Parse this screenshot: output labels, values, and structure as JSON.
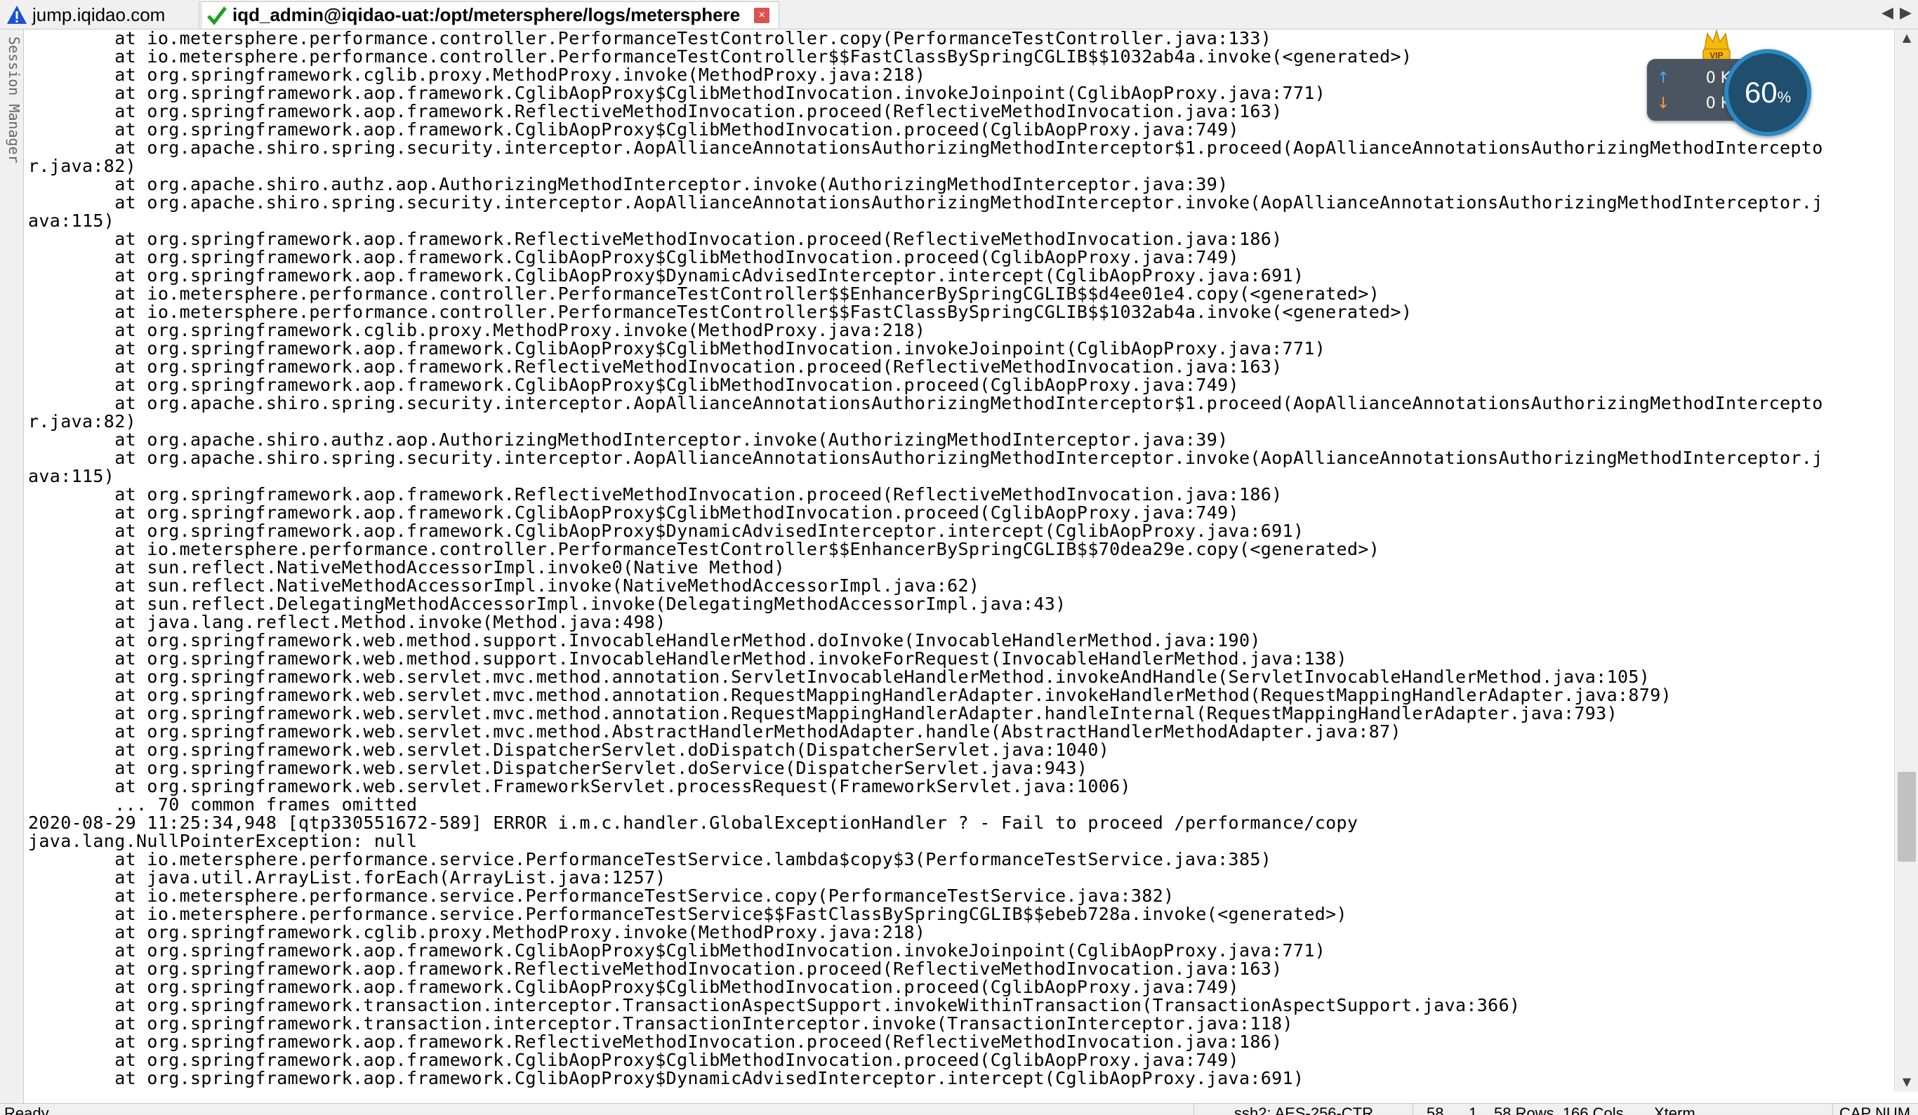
{
  "tabs": [
    {
      "label": "jump.iqidao.com",
      "icon": "warning-icon",
      "color": "#1a4fd6"
    },
    {
      "label": "iqd_admin@iqidao-uat:/opt/metersphere/logs/metersphere",
      "icon": "checkmark-icon",
      "color": "#1aa11a"
    }
  ],
  "side_panel": {
    "label": "Session Manager"
  },
  "network_widget": {
    "upload": "0 K/s",
    "download": "0 K/s",
    "percent": "60",
    "percent_unit": "%",
    "badge": "VIP"
  },
  "terminal": {
    "lines": [
      "        at io.metersphere.performance.controller.PerformanceTestController.copy(PerformanceTestController.java:133)",
      "        at io.metersphere.performance.controller.PerformanceTestController$$FastClassBySpringCGLIB$$1032ab4a.invoke(<generated>)",
      "        at org.springframework.cglib.proxy.MethodProxy.invoke(MethodProxy.java:218)",
      "        at org.springframework.aop.framework.CglibAopProxy$CglibMethodInvocation.invokeJoinpoint(CglibAopProxy.java:771)",
      "        at org.springframework.aop.framework.ReflectiveMethodInvocation.proceed(ReflectiveMethodInvocation.java:163)",
      "        at org.springframework.aop.framework.CglibAopProxy$CglibMethodInvocation.proceed(CglibAopProxy.java:749)",
      "        at org.apache.shiro.spring.security.interceptor.AopAllianceAnnotationsAuthorizingMethodInterceptor$1.proceed(AopAllianceAnnotationsAuthorizingMethodIntercepto",
      "r.java:82)",
      "        at org.apache.shiro.authz.aop.AuthorizingMethodInterceptor.invoke(AuthorizingMethodInterceptor.java:39)",
      "        at org.apache.shiro.spring.security.interceptor.AopAllianceAnnotationsAuthorizingMethodInterceptor.invoke(AopAllianceAnnotationsAuthorizingMethodInterceptor.j",
      "ava:115)",
      "        at org.springframework.aop.framework.ReflectiveMethodInvocation.proceed(ReflectiveMethodInvocation.java:186)",
      "        at org.springframework.aop.framework.CglibAopProxy$CglibMethodInvocation.proceed(CglibAopProxy.java:749)",
      "        at org.springframework.aop.framework.CglibAopProxy$DynamicAdvisedInterceptor.intercept(CglibAopProxy.java:691)",
      "        at io.metersphere.performance.controller.PerformanceTestController$$EnhancerBySpringCGLIB$$d4ee01e4.copy(<generated>)",
      "        at io.metersphere.performance.controller.PerformanceTestController$$FastClassBySpringCGLIB$$1032ab4a.invoke(<generated>)",
      "        at org.springframework.cglib.proxy.MethodProxy.invoke(MethodProxy.java:218)",
      "        at org.springframework.aop.framework.CglibAopProxy$CglibMethodInvocation.invokeJoinpoint(CglibAopProxy.java:771)",
      "        at org.springframework.aop.framework.ReflectiveMethodInvocation.proceed(ReflectiveMethodInvocation.java:163)",
      "        at org.springframework.aop.framework.CglibAopProxy$CglibMethodInvocation.proceed(CglibAopProxy.java:749)",
      "        at org.apache.shiro.spring.security.interceptor.AopAllianceAnnotationsAuthorizingMethodInterceptor$1.proceed(AopAllianceAnnotationsAuthorizingMethodIntercepto",
      "r.java:82)",
      "        at org.apache.shiro.authz.aop.AuthorizingMethodInterceptor.invoke(AuthorizingMethodInterceptor.java:39)",
      "        at org.apache.shiro.spring.security.interceptor.AopAllianceAnnotationsAuthorizingMethodInterceptor.invoke(AopAllianceAnnotationsAuthorizingMethodInterceptor.j",
      "ava:115)",
      "        at org.springframework.aop.framework.ReflectiveMethodInvocation.proceed(ReflectiveMethodInvocation.java:186)",
      "        at org.springframework.aop.framework.CglibAopProxy$CglibMethodInvocation.proceed(CglibAopProxy.java:749)",
      "        at org.springframework.aop.framework.CglibAopProxy$DynamicAdvisedInterceptor.intercept(CglibAopProxy.java:691)",
      "        at io.metersphere.performance.controller.PerformanceTestController$$EnhancerBySpringCGLIB$$70dea29e.copy(<generated>)",
      "        at sun.reflect.NativeMethodAccessorImpl.invoke0(Native Method)",
      "        at sun.reflect.NativeMethodAccessorImpl.invoke(NativeMethodAccessorImpl.java:62)",
      "        at sun.reflect.DelegatingMethodAccessorImpl.invoke(DelegatingMethodAccessorImpl.java:43)",
      "        at java.lang.reflect.Method.invoke(Method.java:498)",
      "        at org.springframework.web.method.support.InvocableHandlerMethod.doInvoke(InvocableHandlerMethod.java:190)",
      "        at org.springframework.web.method.support.InvocableHandlerMethod.invokeForRequest(InvocableHandlerMethod.java:138)",
      "        at org.springframework.web.servlet.mvc.method.annotation.ServletInvocableHandlerMethod.invokeAndHandle(ServletInvocableHandlerMethod.java:105)",
      "        at org.springframework.web.servlet.mvc.method.annotation.RequestMappingHandlerAdapter.invokeHandlerMethod(RequestMappingHandlerAdapter.java:879)",
      "        at org.springframework.web.servlet.mvc.method.annotation.RequestMappingHandlerAdapter.handleInternal(RequestMappingHandlerAdapter.java:793)",
      "        at org.springframework.web.servlet.mvc.method.AbstractHandlerMethodAdapter.handle(AbstractHandlerMethodAdapter.java:87)",
      "        at org.springframework.web.servlet.DispatcherServlet.doDispatch(DispatcherServlet.java:1040)",
      "        at org.springframework.web.servlet.DispatcherServlet.doService(DispatcherServlet.java:943)",
      "        at org.springframework.web.servlet.FrameworkServlet.processRequest(FrameworkServlet.java:1006)",
      "        ... 70 common frames omitted",
      "2020-08-29 11:25:34,948 [qtp330551672-589] ERROR i.m.c.handler.GlobalExceptionHandler ? - Fail to proceed /performance/copy",
      "java.lang.NullPointerException: null",
      "        at io.metersphere.performance.service.PerformanceTestService.lambda$copy$3(PerformanceTestService.java:385)",
      "        at java.util.ArrayList.forEach(ArrayList.java:1257)",
      "        at io.metersphere.performance.service.PerformanceTestService.copy(PerformanceTestService.java:382)",
      "        at io.metersphere.performance.service.PerformanceTestService$$FastClassBySpringCGLIB$$ebeb728a.invoke(<generated>)",
      "        at org.springframework.cglib.proxy.MethodProxy.invoke(MethodProxy.java:218)",
      "        at org.springframework.aop.framework.CglibAopProxy$CglibMethodInvocation.invokeJoinpoint(CglibAopProxy.java:771)",
      "        at org.springframework.aop.framework.ReflectiveMethodInvocation.proceed(ReflectiveMethodInvocation.java:163)",
      "        at org.springframework.aop.framework.CglibAopProxy$CglibMethodInvocation.proceed(CglibAopProxy.java:749)",
      "        at org.springframework.transaction.interceptor.TransactionAspectSupport.invokeWithinTransaction(TransactionAspectSupport.java:366)",
      "        at org.springframework.transaction.interceptor.TransactionInterceptor.invoke(TransactionInterceptor.java:118)",
      "        at org.springframework.aop.framework.ReflectiveMethodInvocation.proceed(ReflectiveMethodInvocation.java:186)",
      "        at org.springframework.aop.framework.CglibAopProxy$CglibMethodInvocation.proceed(CglibAopProxy.java:749)",
      "        at org.springframework.aop.framework.CglibAopProxy$DynamicAdvisedInterceptor.intercept(CglibAopProxy.java:691)"
    ]
  },
  "status_bar": {
    "ready": "Ready",
    "connection": "ssh2: AES-256-CTR",
    "row": "58,",
    "col": "1",
    "size": "58 Rows, 166 Cols",
    "term": "Xterm",
    "keys": "CAP NUM"
  }
}
